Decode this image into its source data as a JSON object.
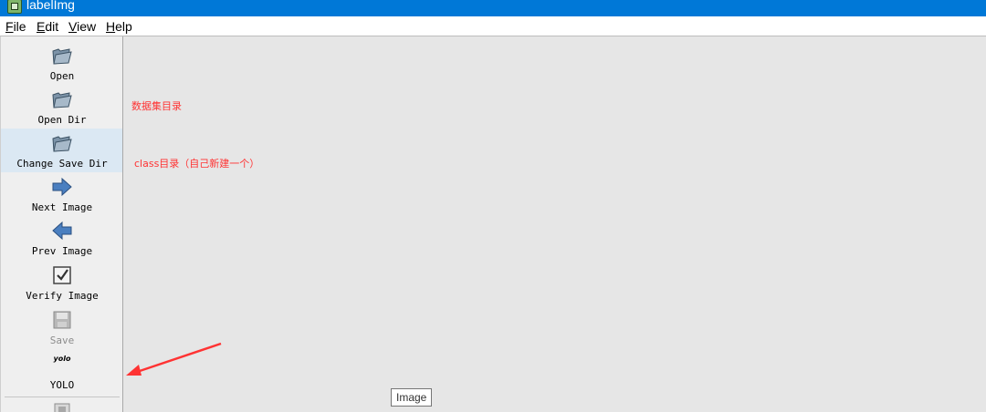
{
  "window": {
    "title": "labelImg"
  },
  "menu": {
    "items": [
      {
        "mnemonic": "F",
        "rest": "ile"
      },
      {
        "mnemonic": "E",
        "rest": "dit"
      },
      {
        "mnemonic": "V",
        "rest": "iew"
      },
      {
        "mnemonic": "H",
        "rest": "elp"
      }
    ]
  },
  "toolbar": {
    "open": {
      "label": "Open",
      "icon": "folder-icon"
    },
    "open_dir": {
      "label": "Open Dir",
      "icon": "folder-icon"
    },
    "change_save_dir": {
      "label": "Change Save Dir",
      "icon": "folder-icon",
      "highlighted": true
    },
    "next_image": {
      "label": "Next Image",
      "icon": "arrow-right-icon"
    },
    "prev_image": {
      "label": "Prev Image",
      "icon": "arrow-left-icon"
    },
    "verify_image": {
      "label": "Verify Image",
      "icon": "checkbox-icon"
    },
    "save": {
      "label": "Save",
      "icon": "save-icon",
      "disabled": true
    },
    "format": {
      "icon_text": "yolo",
      "label": "YOLO"
    }
  },
  "annotations": {
    "open_dir_note": "数据集目录",
    "save_dir_note": "class目录（自己新建一个）"
  },
  "tooltip": {
    "text": "Image"
  },
  "colors": {
    "titlebar": "#0078d7",
    "annotation": "#ff3333",
    "highlight": "#dbe8f3"
  }
}
